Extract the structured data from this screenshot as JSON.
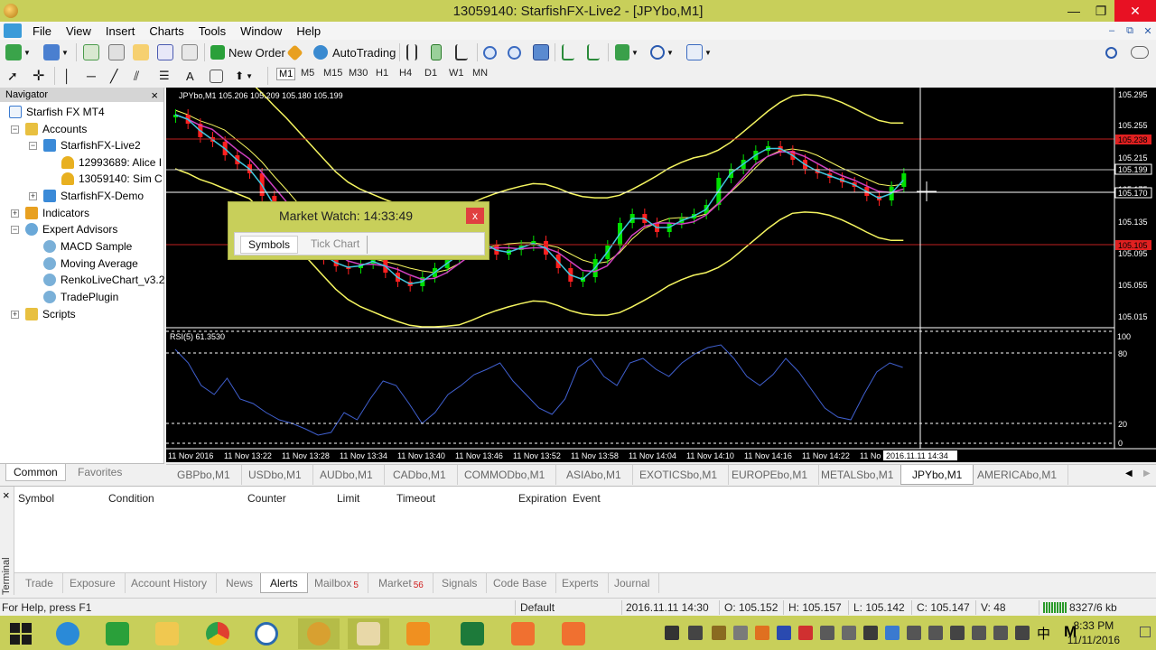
{
  "window": {
    "title": "13059140: StarfishFX-Live2 - [JPYbo,M1]",
    "minimize": "—",
    "restore": "❐",
    "close": "✕",
    "mdi_minimize": "–",
    "mdi_restore": "⧉",
    "mdi_close": "✕"
  },
  "menu": [
    "File",
    "View",
    "Insert",
    "Charts",
    "Tools",
    "Window",
    "Help"
  ],
  "toolbar": {
    "new_order": "New Order",
    "autotrading": "AutoTrading",
    "timeframes": [
      "M1",
      "M5",
      "M15",
      "M30",
      "H1",
      "H4",
      "D1",
      "W1",
      "MN"
    ],
    "text_tool": "A"
  },
  "navigator": {
    "title": "Navigator",
    "close": "×",
    "root": "Starfish FX MT4",
    "accounts": "Accounts",
    "live_server": "StarfishFX-Live2",
    "account1": "12993689: Alice I",
    "account2": "13059140: Sim C",
    "demo_server": "StarfishFX-Demo",
    "indicators": "Indicators",
    "experts": "Expert Advisors",
    "ea_items": [
      "MACD Sample",
      "Moving Average",
      "RenkoLiveChart_v3.2",
      "TradePlugin"
    ],
    "scripts": "Scripts",
    "tabs": [
      "Common",
      "Favorites"
    ]
  },
  "chart": {
    "symbol_info": "JPYbo,M1  105.206 105.209 105.180 105.199",
    "indicator_label": "RSI(5) 61.3530",
    "price_labels": [
      "105.295",
      "105.255",
      "105.215",
      "105.175",
      "105.135",
      "105.095",
      "105.055",
      "105.015"
    ],
    "red_label_top": "105.238",
    "bid_label": "105.199",
    "cross_label": "105.170",
    "red_label_bottom": "105.105",
    "rsi_labels": [
      "100",
      "80",
      "20",
      "0"
    ],
    "time_labels": [
      "11 Nov 2016",
      "11 Nov 13:22",
      "11 Nov 13:28",
      "11 Nov 13:34",
      "11 Nov 13:40",
      "11 Nov 13:46",
      "11 Nov 13:52",
      "11 Nov 13:58",
      "11 Nov 14:04",
      "11 Nov 14:10",
      "11 Nov 14:16",
      "11 Nov 14:22",
      "11 No"
    ],
    "cursor_time": "2016.11.11 14:34",
    "colors": {
      "background": "#000000",
      "bull": "#00e000",
      "bear": "#ff2020",
      "bands": "#f5f560",
      "ma_fast": "#40c8e0",
      "ma_slow": "#d040c0",
      "rsi": "#4060d0"
    }
  },
  "market_watch": {
    "title": "Market Watch: 14:33:49",
    "close": "x",
    "tabs": [
      "Symbols",
      "Tick Chart"
    ]
  },
  "chart_tabs": [
    "GBPbo,M1",
    "USDbo,M1",
    "AUDbo,M1",
    "CADbo,M1",
    "COMMODbo,M1",
    "ASIAbo,M1",
    "EXOTICSbo,M1",
    "EUROPEbo,M1",
    "METALSbo,M1",
    "JPYbo,M1",
    "AMERICAbo,M1"
  ],
  "terminal": {
    "side_label": "Terminal",
    "close": "×",
    "columns": [
      "Symbol",
      "Condition",
      "Counter",
      "Limit",
      "Timeout",
      "Expiration",
      "Event"
    ],
    "tabs": [
      "Trade",
      "Exposure",
      "Account History",
      "News",
      "Alerts",
      "Mailbox",
      "Market",
      "Signals",
      "Code Base",
      "Experts",
      "Journal"
    ],
    "mailbox_badge": "5",
    "market_badge": "56"
  },
  "status": {
    "help": "For Help, press F1",
    "profile": "Default",
    "datetime": "2016.11.11 14:30",
    "open": "O: 105.152",
    "high": "H: 105.157",
    "low": "L: 105.142",
    "close": "C: 105.147",
    "volume": "V: 48",
    "traffic": "8327/6 kb"
  },
  "taskbar": {
    "time": "8:33 PM",
    "date": "11/11/2016",
    "ime_char": "中",
    "ime_mode": "M"
  }
}
